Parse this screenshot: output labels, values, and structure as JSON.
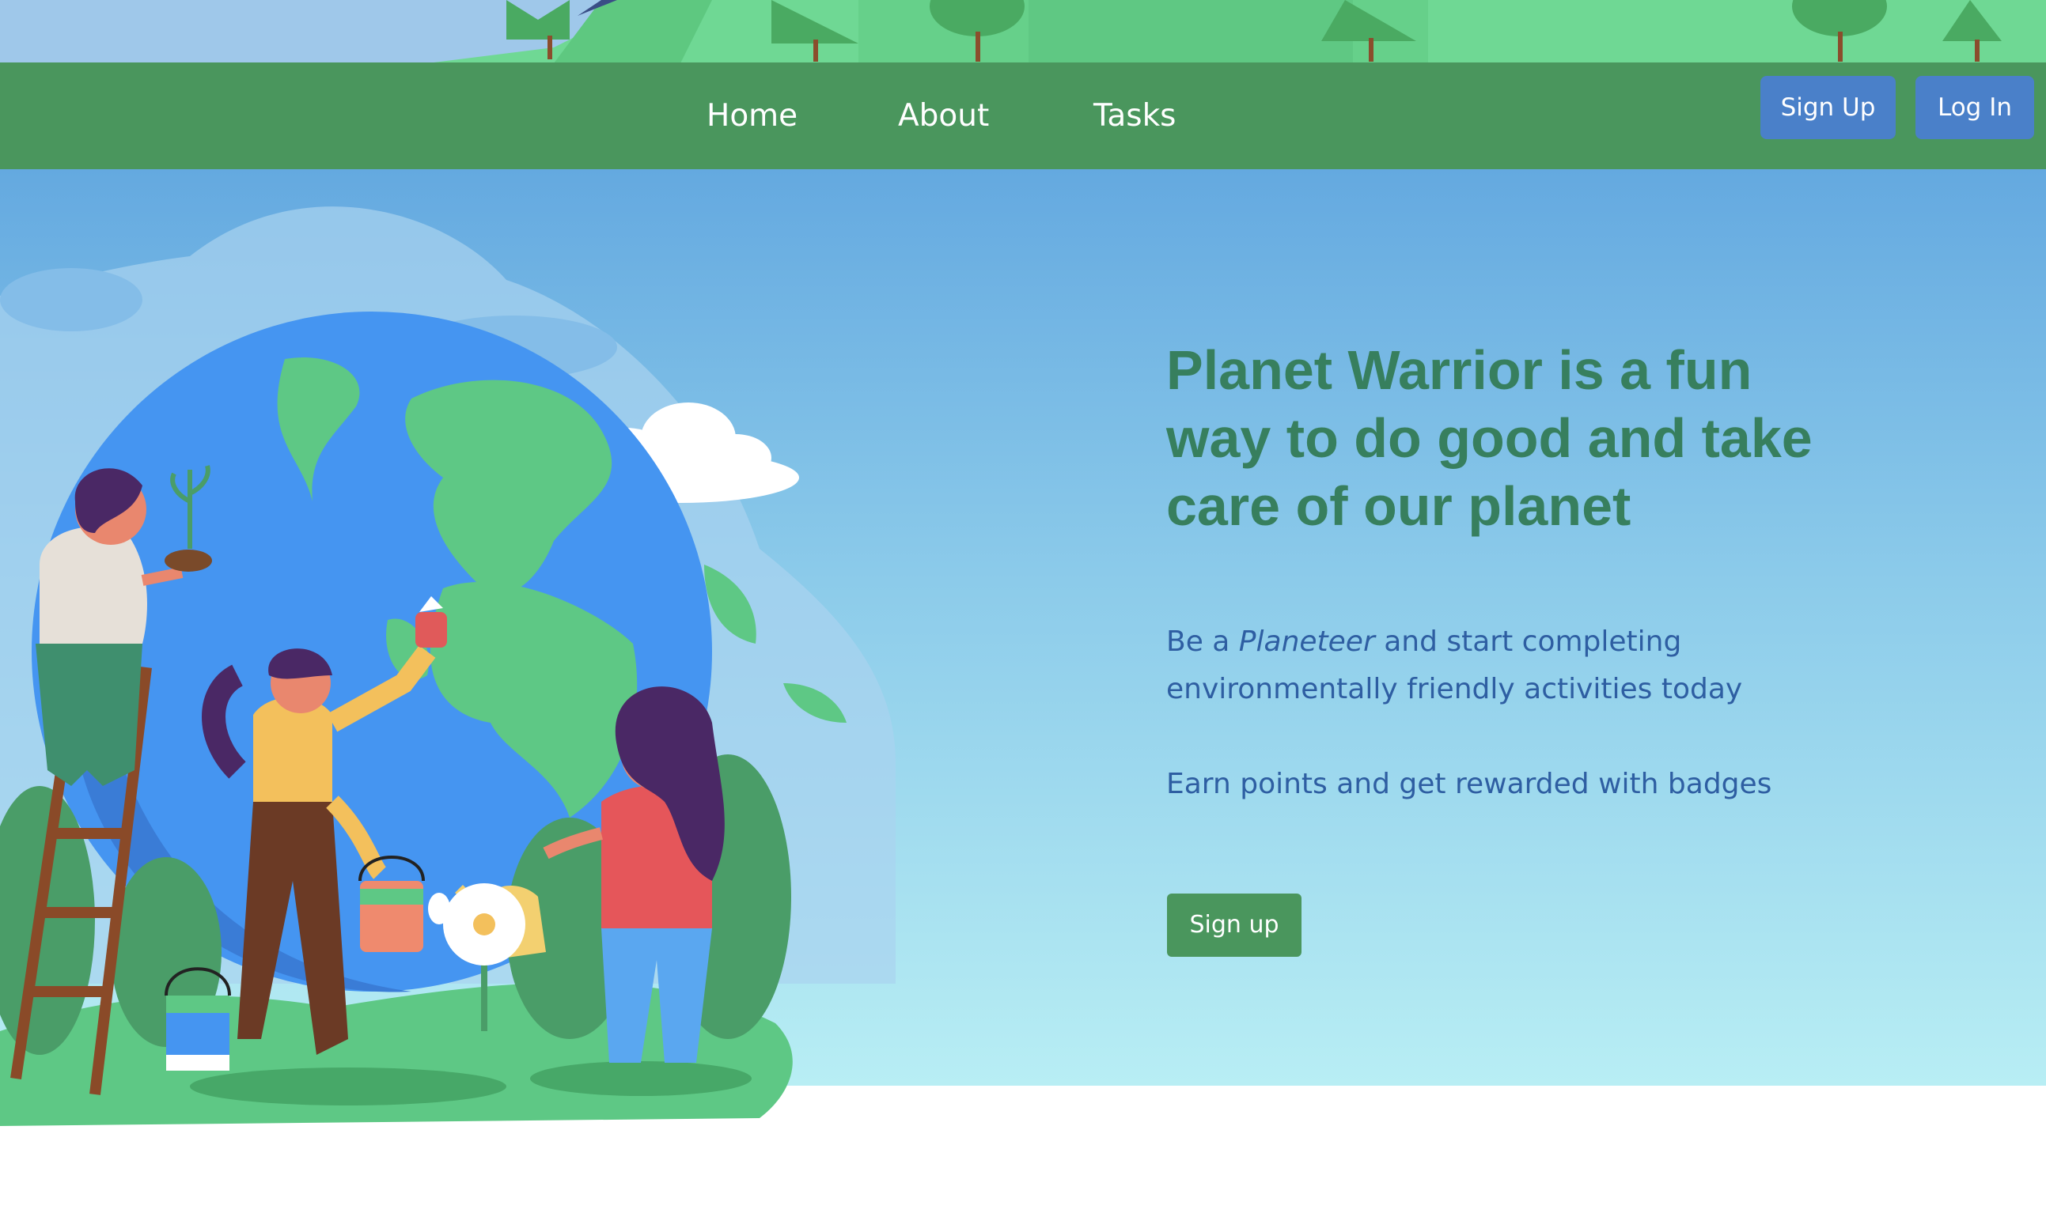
{
  "nav": {
    "links": [
      "Home",
      "About",
      "Tasks"
    ],
    "signup_label": "Sign Up",
    "login_label": "Log In"
  },
  "hero": {
    "title": "Planet Warrior is a fun way to do good and take care of our planet",
    "paragraph1_prefix": "Be a ",
    "paragraph1_emphasis": "Planeteer",
    "paragraph1_suffix": " and start completing environmentally friendly activities today",
    "paragraph2": "Earn points and get rewarded with badges",
    "cta_label": "Sign up"
  },
  "colors": {
    "navbar": "#4a965d",
    "nav_button": "#4a80c9",
    "title": "#377f5e",
    "body_text": "#2e5ea2",
    "cta_button": "#4a965d"
  }
}
